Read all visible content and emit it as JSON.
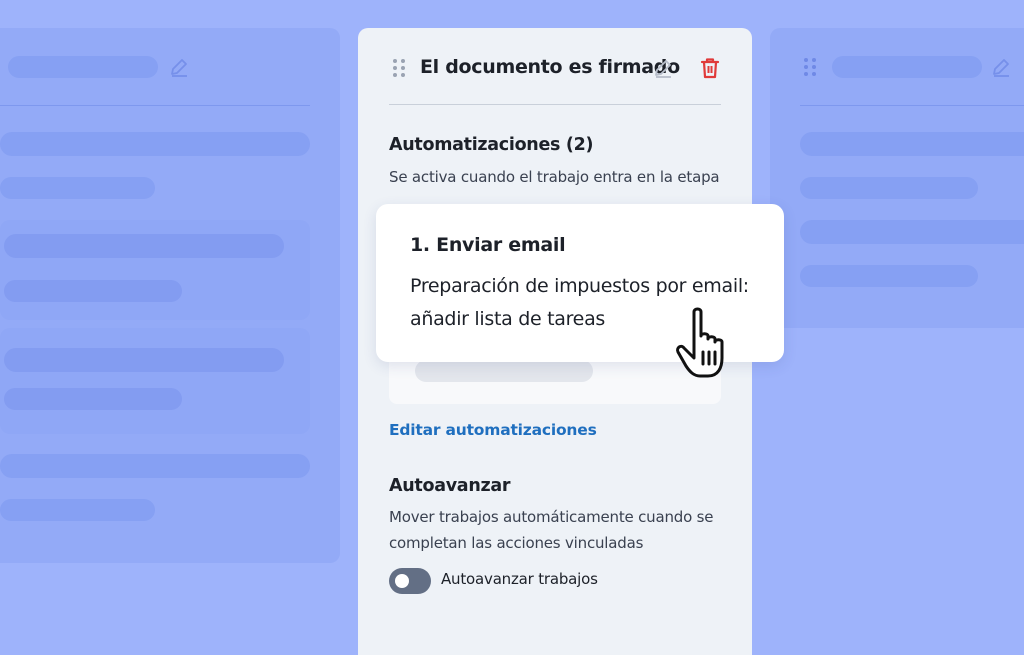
{
  "stage": {
    "title": "El documento es firmado",
    "drag_icon": "drag-handle-icon",
    "edit_icon": "pencil-icon",
    "delete_icon": "trash-icon",
    "delete_color": "#e03a3a"
  },
  "automations": {
    "heading": "Automatizaciones (2)",
    "description": "Se activa cuando el trabajo entra en la etapa",
    "edit_link": "Editar automatizaciones",
    "link_color": "#1f6fbf"
  },
  "popup": {
    "title": "1. Enviar email",
    "body": "Preparación de impuestos por email: añadir lista de tareas"
  },
  "autoadvance": {
    "heading": "Autoavanzar",
    "description": "Mover trabajos automáticamente cuando se completan las acciones vinculadas",
    "toggle_label": "Autoavanzar trabajos",
    "toggle_on": false
  },
  "colors": {
    "background": "#9eb3fb",
    "panel": "#eef2f7"
  }
}
